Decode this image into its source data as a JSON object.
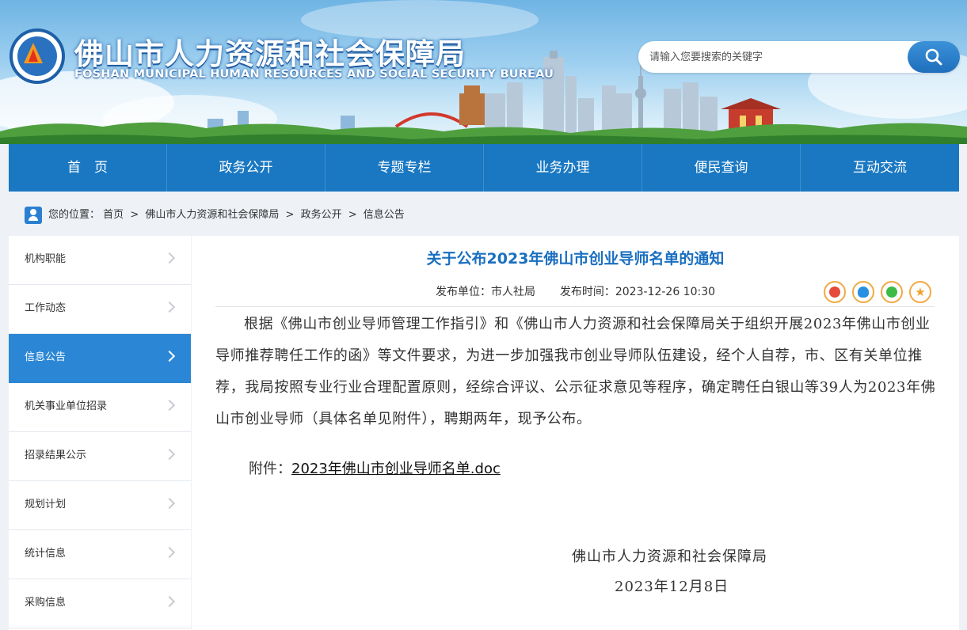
{
  "header": {
    "title": "佛山市人力资源和社会保障局",
    "subtitle": "FOSHAN MUNICIPAL HUMAN RESOURCES AND SOCIAL SECURITY BUREAU",
    "search_placeholder": "请输入您要搜索的关键字"
  },
  "nav": {
    "items": [
      {
        "label": "首　页"
      },
      {
        "label": "政务公开"
      },
      {
        "label": "专题专栏"
      },
      {
        "label": "业务办理"
      },
      {
        "label": "便民查询"
      },
      {
        "label": "互动交流"
      }
    ]
  },
  "breadcrumb": {
    "prefix": "您的位置：",
    "items": [
      "首页",
      "佛山市人力资源和社会保障局",
      "政务公开",
      "信息公告"
    ],
    "separator": ">"
  },
  "sidebar": {
    "active_index": 2,
    "items": [
      {
        "label": "机构职能"
      },
      {
        "label": "工作动态"
      },
      {
        "label": "信息公告"
      },
      {
        "label": "机关事业单位招录"
      },
      {
        "label": "招录结果公示"
      },
      {
        "label": "规划计划"
      },
      {
        "label": "统计信息"
      },
      {
        "label": "采购信息"
      }
    ]
  },
  "article": {
    "title": "关于公布2023年佛山市创业导师名单的通知",
    "publisher_label": "发布单位：",
    "publisher": "市人社局",
    "time_label": "发布时间：",
    "time": "2023-12-26 10:30",
    "body": "根据《佛山市创业导师管理工作指引》和《佛山市人力资源和社会保障局关于组织开展2023年佛山市创业导师推荐聘任工作的函》等文件要求，为进一步加强我市创业导师队伍建设，经个人自荐，市、区有关单位推荐，我局按照专业行业合理配置原则，经综合评议、公示征求意见等程序，确定聘任白银山等39人为2023年佛山市创业导师（具体名单见附件），聘期两年，现予公布。",
    "attachment_label": "附件：",
    "attachment_name": "2023年佛山市创业导师名单.doc",
    "signature_org": "佛山市人力资源和社会保障局",
    "signature_date": "2023年12月8日"
  },
  "share_icons": [
    "weibo-icon",
    "qq-icon",
    "wechat-icon",
    "favorite-star-icon"
  ],
  "colors": {
    "nav_bg": "#1a78c2",
    "sidebar_active": "#2b87d6",
    "title_blue": "#1a6fc0",
    "share_border": "#f1a944"
  }
}
